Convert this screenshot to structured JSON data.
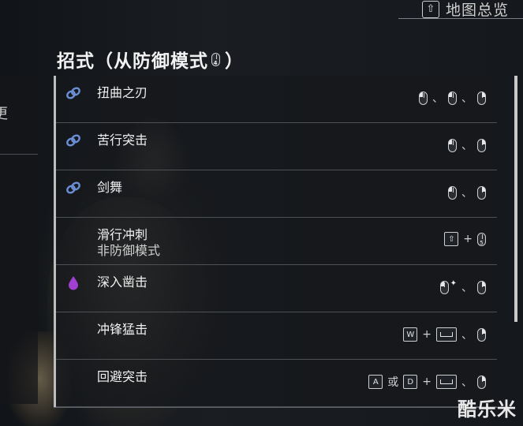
{
  "map_hint": {
    "key": "⇧",
    "label": "地图总览"
  },
  "left_panel": {
    "stub_text": "更"
  },
  "title": {
    "prefix": "招式（从防御模式",
    "mouse_num": "4",
    "suffix": "）"
  },
  "colors": {
    "chain_icon": "#6b8fd6",
    "special_icon": "#a13fd1"
  },
  "moves": [
    {
      "name": "扭曲之刃",
      "sub": "",
      "icon": "chain-icon",
      "inputs": [
        {
          "type": "mouse",
          "btn": "left"
        },
        {
          "type": "sep",
          "text": "、"
        },
        {
          "type": "mouse",
          "btn": "left"
        },
        {
          "type": "sep",
          "text": "、"
        },
        {
          "type": "mouse",
          "btn": "right"
        }
      ]
    },
    {
      "name": "苦行突击",
      "sub": "",
      "icon": "chain-icon",
      "inputs": [
        {
          "type": "mouse",
          "btn": "left"
        },
        {
          "type": "sep",
          "text": "、"
        },
        {
          "type": "mouse",
          "btn": "right"
        }
      ]
    },
    {
      "name": "剑舞",
      "sub": "",
      "icon": "chain-icon",
      "inputs": [
        {
          "type": "mouse",
          "btn": "left"
        },
        {
          "type": "sep",
          "text": "、"
        },
        {
          "type": "mouse",
          "btn": "right"
        }
      ]
    },
    {
      "name": "滑行冲刺",
      "sub": "非防御模式",
      "icon": "",
      "inputs": [
        {
          "type": "key",
          "text": "⇧"
        },
        {
          "type": "sep",
          "text": "+"
        },
        {
          "type": "mouse",
          "btn": "none",
          "num": "5"
        }
      ]
    },
    {
      "name": "深入凿击",
      "sub": "",
      "icon": "special-icon",
      "inputs": [
        {
          "type": "mouse",
          "btn": "left"
        },
        {
          "type": "sparkle",
          "text": "✦"
        },
        {
          "type": "sep",
          "text": "、"
        },
        {
          "type": "mouse",
          "btn": "right"
        }
      ]
    },
    {
      "name": "冲锋猛击",
      "sub": "",
      "icon": "",
      "inputs": [
        {
          "type": "key",
          "text": "W"
        },
        {
          "type": "sep",
          "text": "+"
        },
        {
          "type": "space"
        },
        {
          "type": "sep",
          "text": "、"
        },
        {
          "type": "mouse",
          "btn": "right"
        }
      ]
    },
    {
      "name": "回避突击",
      "sub": "",
      "icon": "",
      "inputs": [
        {
          "type": "key",
          "text": "A"
        },
        {
          "type": "sep",
          "text": "或"
        },
        {
          "type": "key",
          "text": "D"
        },
        {
          "type": "sep",
          "text": "+"
        },
        {
          "type": "space"
        },
        {
          "type": "sep",
          "text": "、"
        },
        {
          "type": "mouse",
          "btn": "right"
        }
      ]
    }
  ],
  "watermark": "酷乐米"
}
